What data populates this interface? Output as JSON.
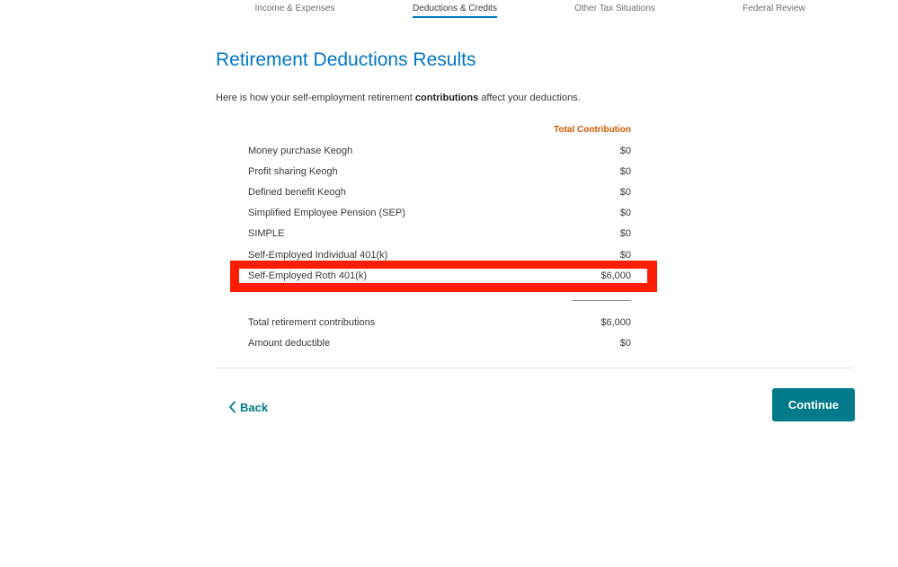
{
  "nav": {
    "tabs": [
      {
        "label": "Income & Expenses",
        "active": false
      },
      {
        "label": "Deductions & Credits",
        "active": true
      },
      {
        "label": "Other Tax Situations",
        "active": false
      },
      {
        "label": "Federal Review",
        "active": false
      }
    ]
  },
  "page": {
    "title": "Retirement Deductions Results",
    "intro_before": "Here is how your self-employment retirement ",
    "intro_bold": "contributions",
    "intro_after": " affect your deductions."
  },
  "table": {
    "column_header": "Total Contribution",
    "rows": [
      {
        "label": "Money purchase Keogh",
        "value": "$0"
      },
      {
        "label": "Profit sharing Keogh",
        "value": "$0"
      },
      {
        "label": "Defined benefit Keogh",
        "value": "$0"
      },
      {
        "label": "Simplified Employee Pension (SEP)",
        "value": "$0"
      },
      {
        "label": "SIMPLE",
        "value": "$0"
      },
      {
        "label": "Self-Employed Individual 401(k)",
        "value": "$0"
      },
      {
        "label": "Self-Employed Roth 401(k)",
        "value": "$6,000"
      }
    ],
    "totals": [
      {
        "label": "Total retirement contributions",
        "value": "$6,000"
      },
      {
        "label": "Amount deductible",
        "value": "$0"
      }
    ]
  },
  "highlight_color": "#ff1e00",
  "accent_color": "#0077c5",
  "button_color": "#007a8a",
  "buttons": {
    "back_label": "Back",
    "back_icon": "chevron-left-icon",
    "continue_label": "Continue"
  }
}
